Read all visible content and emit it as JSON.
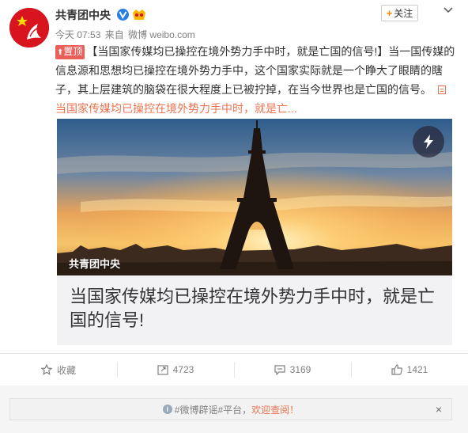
{
  "post": {
    "author": "共青团中央",
    "follow_label": "关注",
    "time": "今天 07:53",
    "source_prefix": "来自",
    "source": "微博 weibo.com",
    "pin_label": "置顶",
    "text": "【当国家传媒均已操控在境外势力手中时，就是亡国的信号!】当一国传媒的信息源和思想均已操控在境外势力手中，这个国家实际就是一个睁大了眼睛的瞎子，其上层建筑的脑袋在很大程度上已被拧掉，在当今世界也是亡国的信号。",
    "link_text": "当国家传媒均已操控在境外势力手中时，就是亡..."
  },
  "card": {
    "image_source": "共青团中央",
    "title": "当国家传媒均已操控在境外势力手中时，就是亡国的信号!"
  },
  "actions": {
    "favorite_label": "收藏",
    "repost_count": "4723",
    "comment_count": "3169",
    "like_count": "1421"
  },
  "notice": {
    "tag1": "#微博辟谣#",
    "tag2": "平台，",
    "welcome": "欢迎查阅！",
    "close": "×"
  },
  "colors": {
    "accent": "#eb7350",
    "follow_plus": "#ff8200",
    "pin_bg": "#eb5f5b",
    "avatar_bg": "#d8141f"
  },
  "icons": [
    "avatar",
    "verified-icon",
    "vip-icon",
    "chevron-down-icon",
    "bolt-icon",
    "star-icon",
    "repost-icon",
    "comment-icon",
    "thumb-up-icon",
    "info-icon",
    "close-icon"
  ]
}
